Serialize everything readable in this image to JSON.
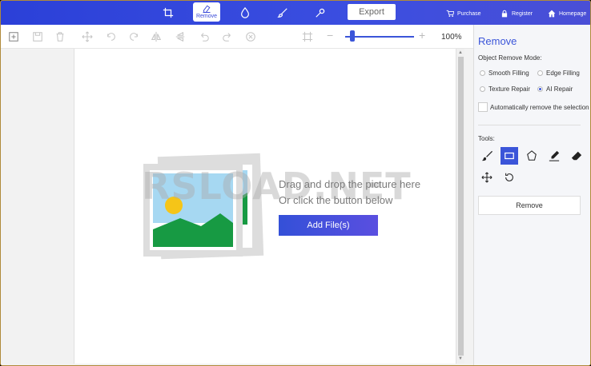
{
  "topbar": {
    "active_tool_label": "Remove",
    "export_label": "Export",
    "nav": [
      {
        "label": "Purchase",
        "icon": "cart-icon"
      },
      {
        "label": "Register",
        "icon": "lock-icon"
      },
      {
        "label": "Homepage",
        "icon": "home-icon"
      }
    ]
  },
  "toolbar": {
    "zoom_level": "100%",
    "zoom_fraction": 0.1
  },
  "canvas": {
    "drop_line1": "Drag and drop the picture here",
    "drop_line2": "Or click the button below",
    "add_button": "Add File(s)",
    "watermark": "RSLOAD.NET"
  },
  "panel": {
    "title": "Remove",
    "mode_label": "Object Remove Mode:",
    "modes": [
      {
        "label": "Smooth Filling",
        "selected": false
      },
      {
        "label": "Edge Filling",
        "selected": false
      },
      {
        "label": "Texture Repair",
        "selected": false
      },
      {
        "label": "AI Repair",
        "selected": true
      }
    ],
    "auto_remove_label": "Automatically remove the selection",
    "tools_label": "Tools:",
    "remove_button": "Remove"
  },
  "colors": {
    "accent": "#3b55d9",
    "topbar": "#3346dc"
  }
}
